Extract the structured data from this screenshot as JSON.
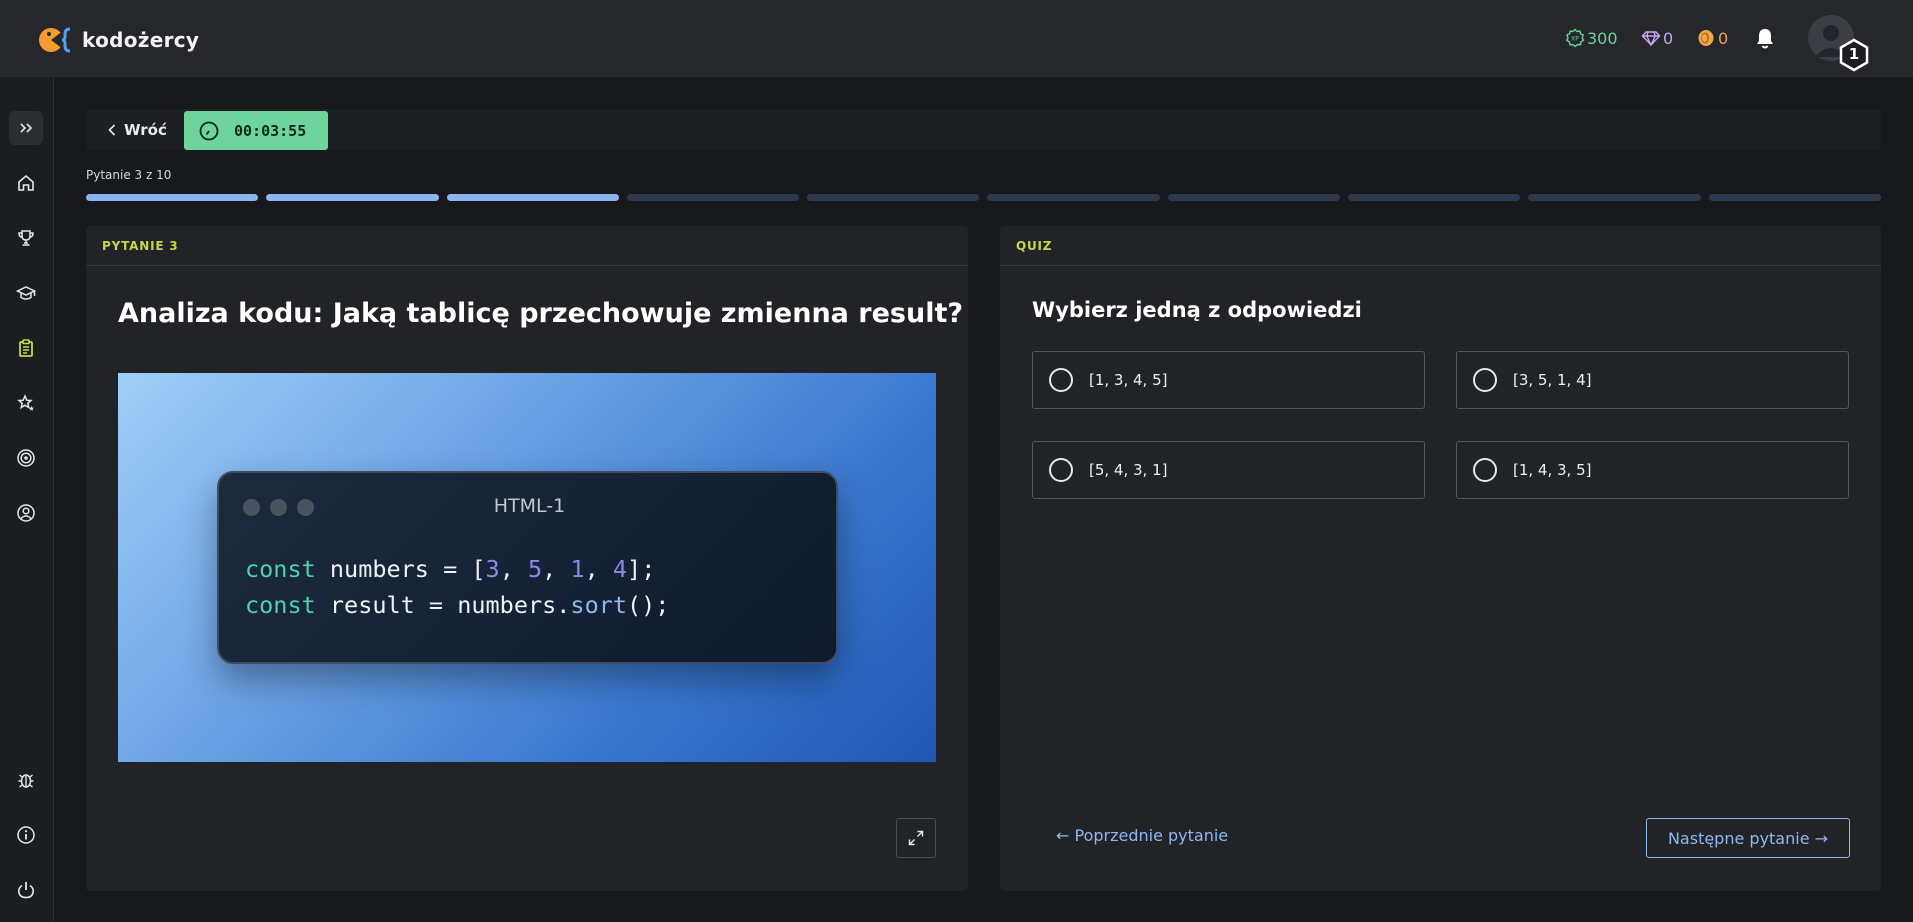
{
  "app": {
    "logo_text": "kodożercy"
  },
  "stats": {
    "xp": "300",
    "gems": "0",
    "coins": "0",
    "level": "1"
  },
  "header": {
    "back_label": "Wróć",
    "timer": "00:03:55"
  },
  "progress": {
    "label": "Pytanie 3 z 10",
    "current": 3,
    "total": 10
  },
  "question_panel": {
    "tag": "PYTANIE 3",
    "title": "Analiza kodu: Jaką tablicę przechowuje zmienna result?",
    "code_window_title": "HTML-1",
    "code_lines": [
      [
        {
          "t": "const",
          "c": "kw"
        },
        {
          "t": " numbers = [",
          "c": ""
        },
        {
          "t": "3",
          "c": "num"
        },
        {
          "t": ", ",
          "c": ""
        },
        {
          "t": "5",
          "c": "num"
        },
        {
          "t": ", ",
          "c": ""
        },
        {
          "t": "1",
          "c": "num"
        },
        {
          "t": ", ",
          "c": ""
        },
        {
          "t": "4",
          "c": "num"
        },
        {
          "t": "];",
          "c": ""
        }
      ],
      [
        {
          "t": "const",
          "c": "kw"
        },
        {
          "t": " result = numbers.",
          "c": ""
        },
        {
          "t": "sort",
          "c": "fn"
        },
        {
          "t": "();",
          "c": ""
        }
      ]
    ]
  },
  "quiz_panel": {
    "tag": "QUIZ",
    "instruction": "Wybierz jedną z odpowiedzi",
    "options": [
      "[1, 3, 4, 5]",
      "[3, 5, 1, 4]",
      "[5, 4, 3, 1]",
      "[1, 4, 3, 5]"
    ],
    "prev_label": "← Poprzednie pytanie",
    "next_label": "Następne pytanie →"
  },
  "colors": {
    "accent_green": "#6ed39d",
    "tag_yellow": "#c2d94a",
    "link_blue": "#8fb8f0",
    "progress_done": "#8fb5f0"
  },
  "icons": {
    "sidebar": [
      "expand-icon",
      "home-icon",
      "trophy-icon",
      "graduation-cap-icon",
      "clipboard-icon",
      "stars-icon",
      "target-icon",
      "user-circle-icon",
      "bug-icon",
      "info-icon",
      "power-icon"
    ]
  }
}
